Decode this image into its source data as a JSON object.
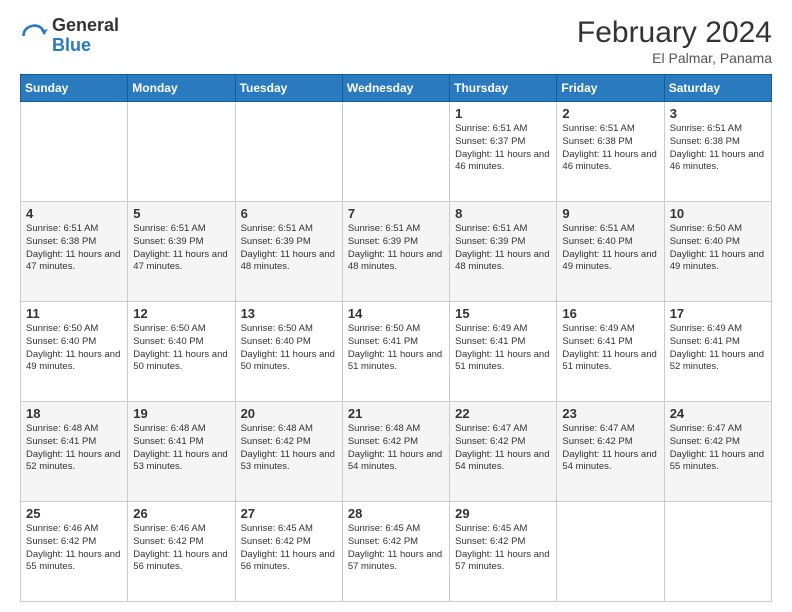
{
  "header": {
    "logo_general": "General",
    "logo_blue": "Blue",
    "month_title": "February 2024",
    "subtitle": "El Palmar, Panama"
  },
  "days_of_week": [
    "Sunday",
    "Monday",
    "Tuesday",
    "Wednesday",
    "Thursday",
    "Friday",
    "Saturday"
  ],
  "weeks": [
    [
      {
        "day": "",
        "info": ""
      },
      {
        "day": "",
        "info": ""
      },
      {
        "day": "",
        "info": ""
      },
      {
        "day": "",
        "info": ""
      },
      {
        "day": "1",
        "info": "Sunrise: 6:51 AM\nSunset: 6:37 PM\nDaylight: 11 hours and 46 minutes."
      },
      {
        "day": "2",
        "info": "Sunrise: 6:51 AM\nSunset: 6:38 PM\nDaylight: 11 hours and 46 minutes."
      },
      {
        "day": "3",
        "info": "Sunrise: 6:51 AM\nSunset: 6:38 PM\nDaylight: 11 hours and 46 minutes."
      }
    ],
    [
      {
        "day": "4",
        "info": "Sunrise: 6:51 AM\nSunset: 6:38 PM\nDaylight: 11 hours and 47 minutes."
      },
      {
        "day": "5",
        "info": "Sunrise: 6:51 AM\nSunset: 6:39 PM\nDaylight: 11 hours and 47 minutes."
      },
      {
        "day": "6",
        "info": "Sunrise: 6:51 AM\nSunset: 6:39 PM\nDaylight: 11 hours and 48 minutes."
      },
      {
        "day": "7",
        "info": "Sunrise: 6:51 AM\nSunset: 6:39 PM\nDaylight: 11 hours and 48 minutes."
      },
      {
        "day": "8",
        "info": "Sunrise: 6:51 AM\nSunset: 6:39 PM\nDaylight: 11 hours and 48 minutes."
      },
      {
        "day": "9",
        "info": "Sunrise: 6:51 AM\nSunset: 6:40 PM\nDaylight: 11 hours and 49 minutes."
      },
      {
        "day": "10",
        "info": "Sunrise: 6:50 AM\nSunset: 6:40 PM\nDaylight: 11 hours and 49 minutes."
      }
    ],
    [
      {
        "day": "11",
        "info": "Sunrise: 6:50 AM\nSunset: 6:40 PM\nDaylight: 11 hours and 49 minutes."
      },
      {
        "day": "12",
        "info": "Sunrise: 6:50 AM\nSunset: 6:40 PM\nDaylight: 11 hours and 50 minutes."
      },
      {
        "day": "13",
        "info": "Sunrise: 6:50 AM\nSunset: 6:40 PM\nDaylight: 11 hours and 50 minutes."
      },
      {
        "day": "14",
        "info": "Sunrise: 6:50 AM\nSunset: 6:41 PM\nDaylight: 11 hours and 51 minutes."
      },
      {
        "day": "15",
        "info": "Sunrise: 6:49 AM\nSunset: 6:41 PM\nDaylight: 11 hours and 51 minutes."
      },
      {
        "day": "16",
        "info": "Sunrise: 6:49 AM\nSunset: 6:41 PM\nDaylight: 11 hours and 51 minutes."
      },
      {
        "day": "17",
        "info": "Sunrise: 6:49 AM\nSunset: 6:41 PM\nDaylight: 11 hours and 52 minutes."
      }
    ],
    [
      {
        "day": "18",
        "info": "Sunrise: 6:48 AM\nSunset: 6:41 PM\nDaylight: 11 hours and 52 minutes."
      },
      {
        "day": "19",
        "info": "Sunrise: 6:48 AM\nSunset: 6:41 PM\nDaylight: 11 hours and 53 minutes."
      },
      {
        "day": "20",
        "info": "Sunrise: 6:48 AM\nSunset: 6:42 PM\nDaylight: 11 hours and 53 minutes."
      },
      {
        "day": "21",
        "info": "Sunrise: 6:48 AM\nSunset: 6:42 PM\nDaylight: 11 hours and 54 minutes."
      },
      {
        "day": "22",
        "info": "Sunrise: 6:47 AM\nSunset: 6:42 PM\nDaylight: 11 hours and 54 minutes."
      },
      {
        "day": "23",
        "info": "Sunrise: 6:47 AM\nSunset: 6:42 PM\nDaylight: 11 hours and 54 minutes."
      },
      {
        "day": "24",
        "info": "Sunrise: 6:47 AM\nSunset: 6:42 PM\nDaylight: 11 hours and 55 minutes."
      }
    ],
    [
      {
        "day": "25",
        "info": "Sunrise: 6:46 AM\nSunset: 6:42 PM\nDaylight: 11 hours and 55 minutes."
      },
      {
        "day": "26",
        "info": "Sunrise: 6:46 AM\nSunset: 6:42 PM\nDaylight: 11 hours and 56 minutes."
      },
      {
        "day": "27",
        "info": "Sunrise: 6:45 AM\nSunset: 6:42 PM\nDaylight: 11 hours and 56 minutes."
      },
      {
        "day": "28",
        "info": "Sunrise: 6:45 AM\nSunset: 6:42 PM\nDaylight: 11 hours and 57 minutes."
      },
      {
        "day": "29",
        "info": "Sunrise: 6:45 AM\nSunset: 6:42 PM\nDaylight: 11 hours and 57 minutes."
      },
      {
        "day": "",
        "info": ""
      },
      {
        "day": "",
        "info": ""
      }
    ]
  ]
}
